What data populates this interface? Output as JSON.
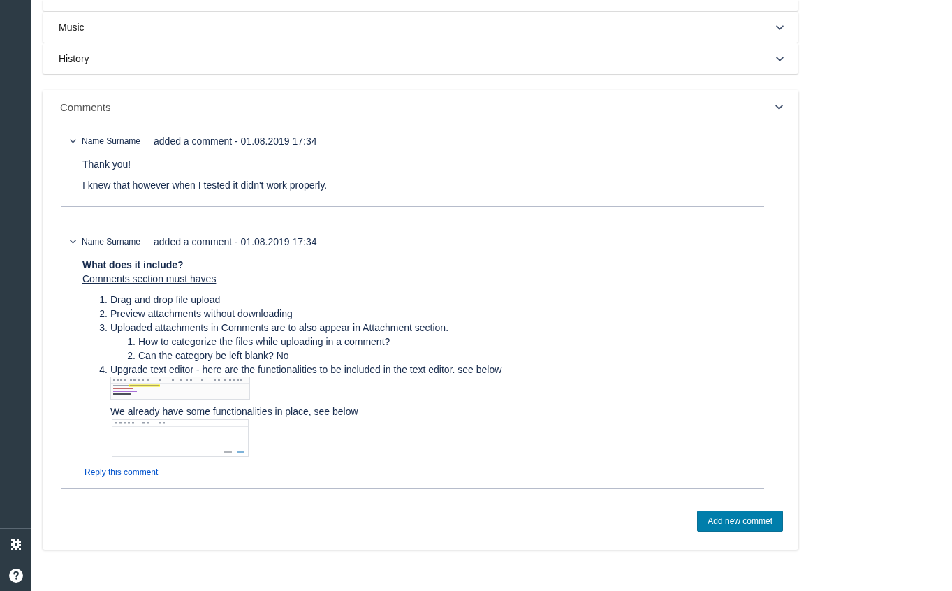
{
  "sections": [
    {
      "title": "Music"
    },
    {
      "title": "History"
    }
  ],
  "comments": {
    "title": "Comments",
    "items": [
      {
        "author": "Name Surname",
        "action": "added a comment - 01.08.2019 17:34",
        "body": [
          {
            "kind": "paragraph",
            "text": "Thank you!"
          },
          {
            "kind": "paragraph",
            "text": "I knew that however when I tested it didn't work properly."
          }
        ]
      },
      {
        "author": "Name Surname",
        "action": "added a comment - 01.08.2019 17:34",
        "body": [
          {
            "kind": "heading",
            "text": "What does it include?"
          },
          {
            "kind": "underlined",
            "text": "Comments section must haves"
          },
          {
            "kind": "list",
            "items": [
              {
                "number": "1.",
                "text": "Drag and drop file upload"
              },
              {
                "number": "2.",
                "text": "Preview attachments without downloading"
              },
              {
                "number": "3.",
                "text": "Uploaded attachments in Comments are to also appear in Attachment section.",
                "children": [
                  {
                    "number": "1.",
                    "text": "How to categorize the files while uploading in a comment?"
                  },
                  {
                    "number": "2.",
                    "text": "Can the category be left blank? No"
                  }
                ]
              },
              {
                "number": "4.",
                "text": "Upgrade text editor - here are the functionalities to be included in the text editor. see below",
                "blocks": [
                  {
                    "kind": "rich-editor-screenshot"
                  },
                  {
                    "kind": "paragraph",
                    "text": "We already have some functionalities in place, see below"
                  },
                  {
                    "kind": "basic-editor-screenshot"
                  }
                ]
              }
            ]
          }
        ],
        "reply_link": "Reply this comment"
      }
    ],
    "add_button": "Add new commet"
  }
}
